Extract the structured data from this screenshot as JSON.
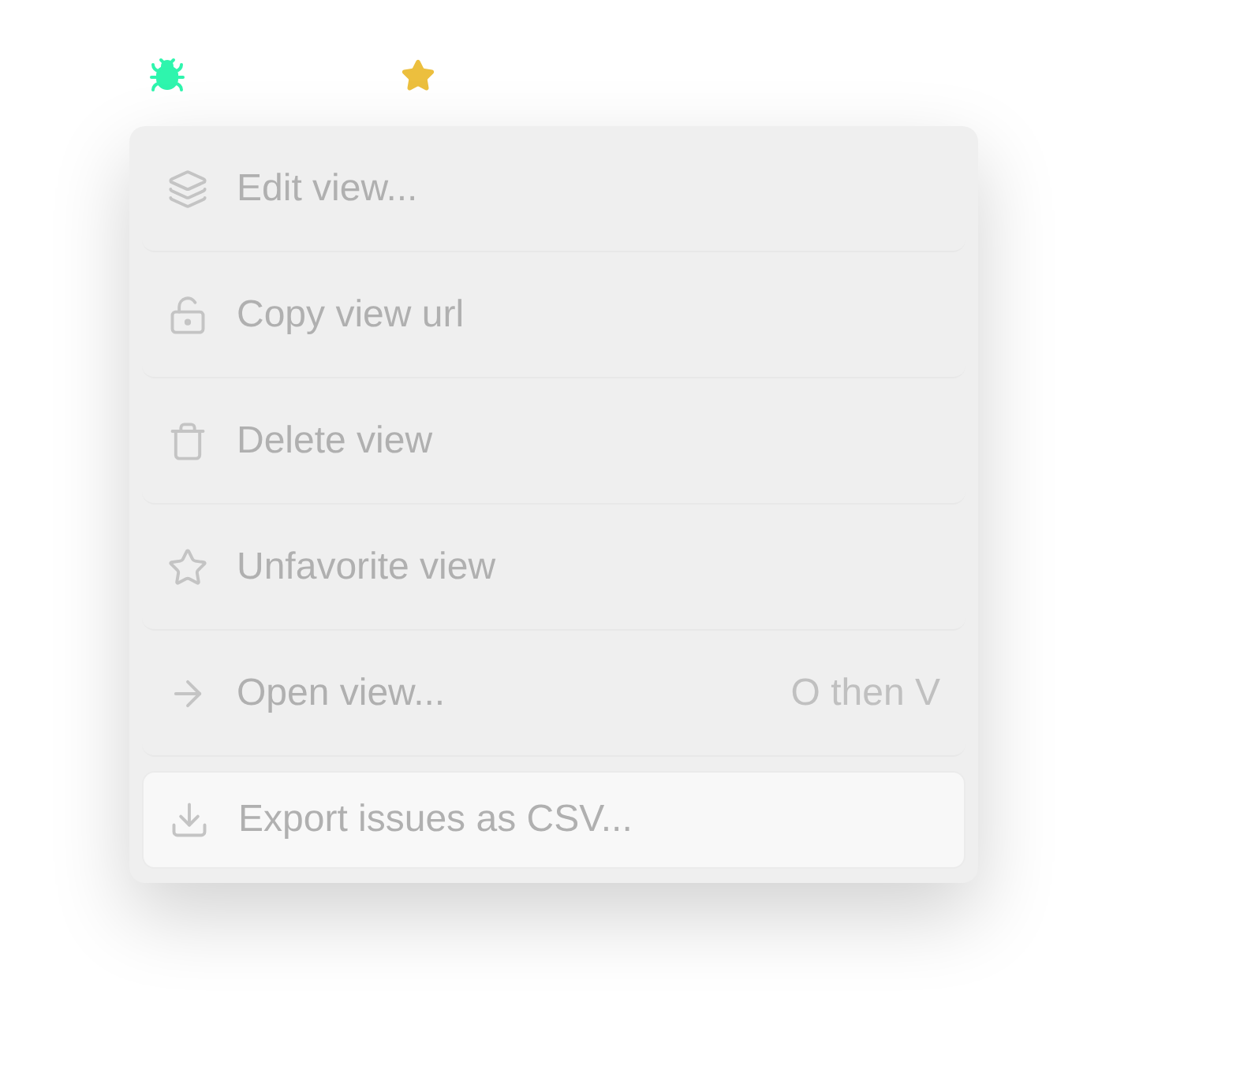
{
  "menu": {
    "items": [
      {
        "kind": "layers",
        "label": "Edit view...",
        "selected": false
      },
      {
        "kind": "unlock",
        "label": "Copy view url",
        "selected": false
      },
      {
        "kind": "trash",
        "label": "Delete view",
        "selected": false
      },
      {
        "kind": "star",
        "label": "Unfavorite view",
        "selected": false
      },
      {
        "kind": "arrow",
        "label": "Open view...",
        "shortcut": "O then V",
        "selected": false
      },
      {
        "kind": "download",
        "label": "Export issues as CSV...",
        "selected": true
      }
    ]
  }
}
